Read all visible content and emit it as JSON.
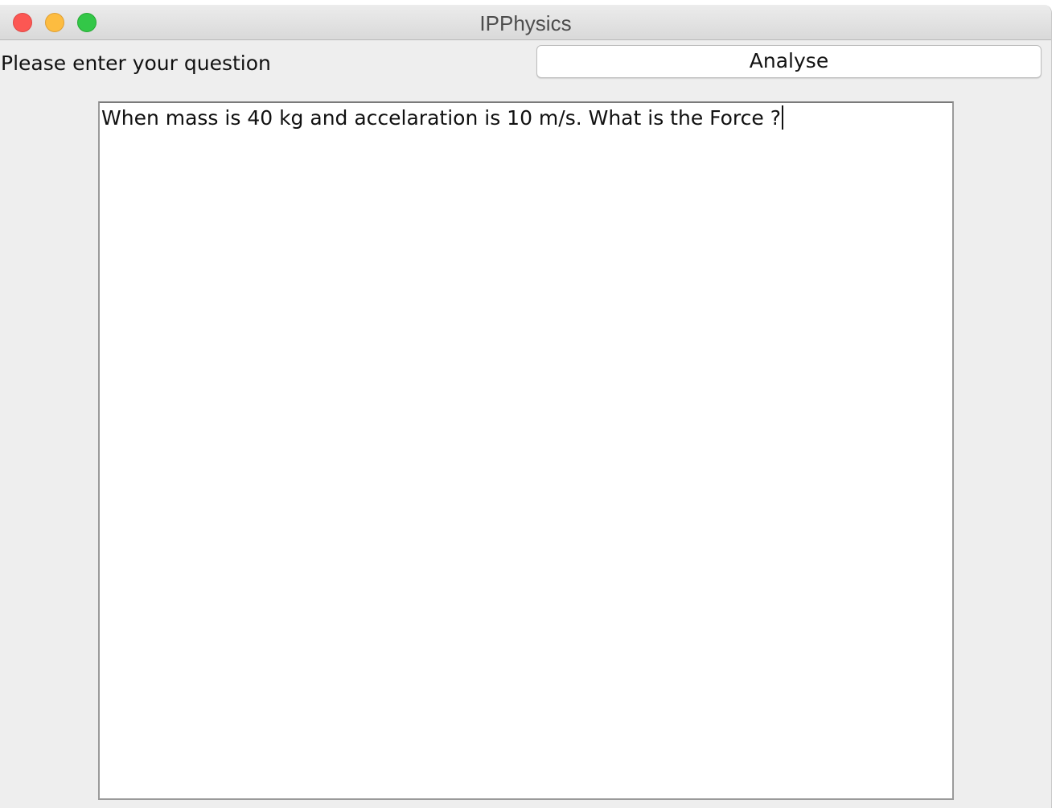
{
  "window": {
    "title": "IPPhysics"
  },
  "form": {
    "prompt_label": "Please enter your question",
    "analyse_label": "Analyse",
    "question_value": "When mass is 40 kg and accelaration is 10 m/s. What is the Force ?"
  }
}
